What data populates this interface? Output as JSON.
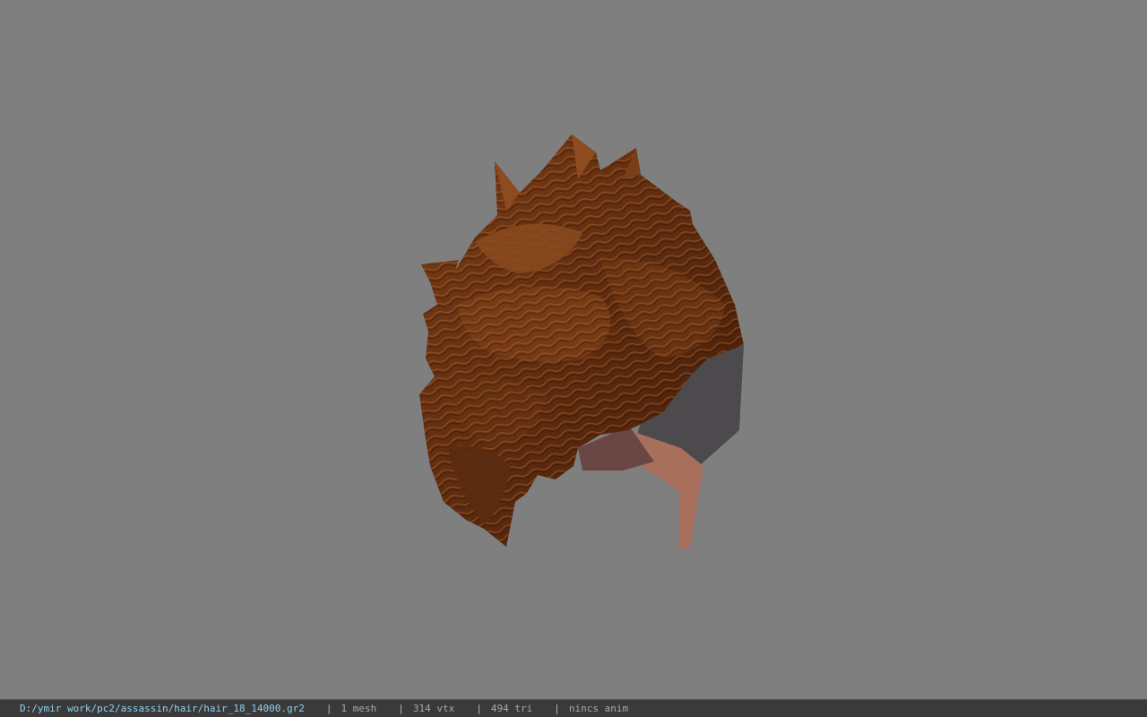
{
  "viewport": {
    "background_color": "#7f7f7f",
    "model": {
      "icon": "hair-mesh-model",
      "hair_color": "#6a3414",
      "hair_highlight": "#b5652a",
      "under_color": "#4c4a4d",
      "skin_color": "#b07563"
    }
  },
  "status_bar": {
    "path": "D:/ymir work/pc2/assassin/hair/hair_18_14000.gr2",
    "separator": "|",
    "mesh": "1 mesh",
    "vtx": "314 vtx",
    "tri": "494 tri",
    "anim": "nincs anim"
  }
}
